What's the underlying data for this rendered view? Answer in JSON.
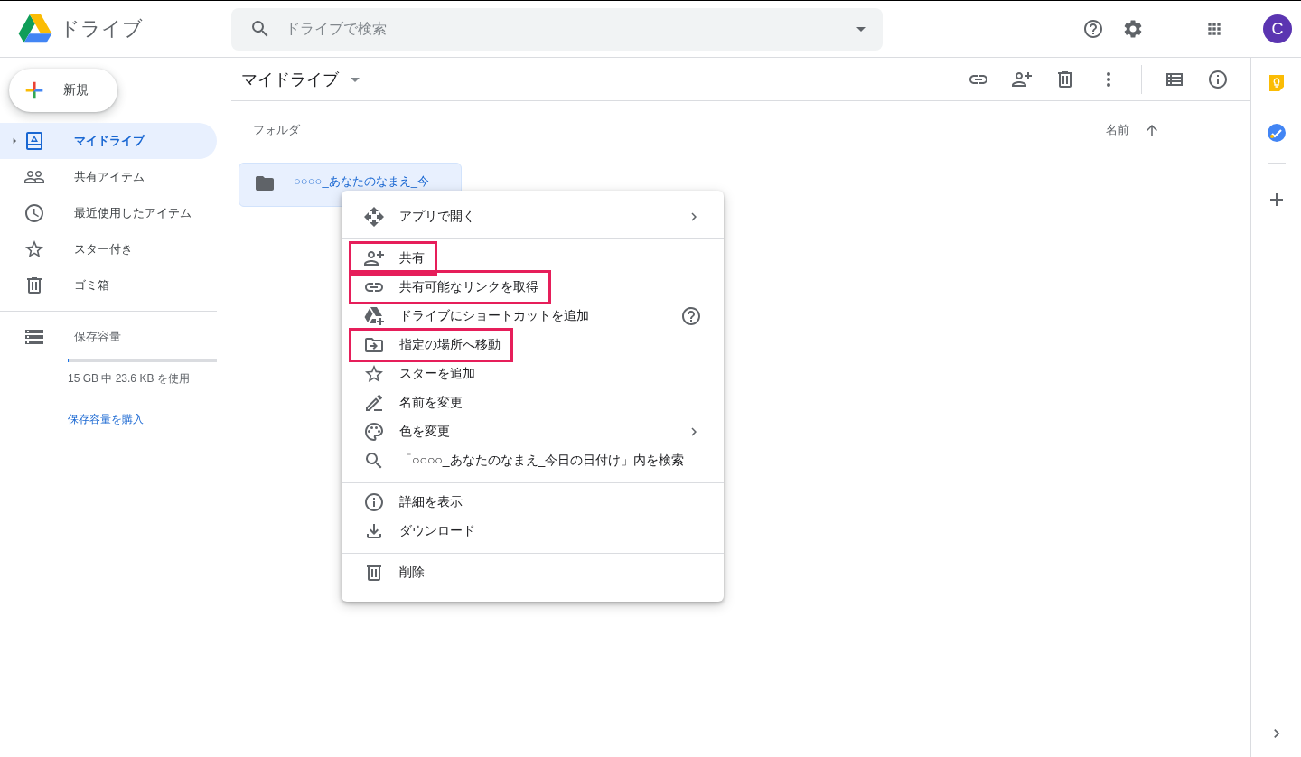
{
  "header": {
    "app_name": "ドライブ",
    "search": {
      "placeholder": "ドライブで検索"
    },
    "avatar": {
      "letter": "C"
    }
  },
  "sidebar": {
    "new_button": "新規",
    "items": [
      {
        "label": "マイドライブ",
        "selected": true,
        "kind": "tree",
        "expanded": false
      },
      {
        "label": "共有アイテム",
        "selected": false,
        "kind": "link"
      },
      {
        "label": "最近使用したアイテム",
        "selected": false,
        "kind": "link"
      },
      {
        "label": "スター付き",
        "selected": false,
        "kind": "link"
      },
      {
        "label": "ゴミ箱",
        "selected": false,
        "kind": "link"
      }
    ],
    "storage": {
      "label": "保存容量",
      "level": 0.0015,
      "usage": "15 GB 中 23.6 KB を使用",
      "buy_link": "保存容量を購入"
    }
  },
  "toolbar": {
    "title": "マイドライブ"
  },
  "content": {
    "section_label": "フォルダ",
    "sort_label": "名前",
    "folders": [
      {
        "name": "○○○○_あなたのなまえ_今",
        "selected": true
      }
    ]
  },
  "context_menu": {
    "groups": [
      {
        "items": [
          {
            "label": "アプリで開く",
            "kind": "submenu",
            "highlighted": false
          }
        ]
      },
      {
        "items": [
          {
            "label": "共有",
            "kind": "plain",
            "highlighted": true
          },
          {
            "label": "共有可能なリンクを取得",
            "kind": "plain",
            "highlighted": true
          },
          {
            "label": "ドライブにショートカットを追加",
            "kind": "help",
            "highlighted": false
          },
          {
            "label": "指定の場所へ移動",
            "kind": "plain",
            "highlighted": true
          },
          {
            "label": "スターを追加",
            "kind": "plain",
            "highlighted": false
          },
          {
            "label": "名前を変更",
            "kind": "plain",
            "highlighted": false
          },
          {
            "label": "色を変更",
            "kind": "submenu",
            "highlighted": false
          },
          {
            "label": "「○○○○_あなたのなまえ_今日の日付け」内を検索",
            "kind": "plain",
            "highlighted": false
          }
        ]
      },
      {
        "items": [
          {
            "label": "詳細を表示",
            "kind": "plain",
            "highlighted": false
          },
          {
            "label": "ダウンロード",
            "kind": "plain",
            "highlighted": false
          }
        ]
      },
      {
        "items": [
          {
            "label": "削除",
            "kind": "plain",
            "highlighted": false
          }
        ]
      }
    ]
  }
}
